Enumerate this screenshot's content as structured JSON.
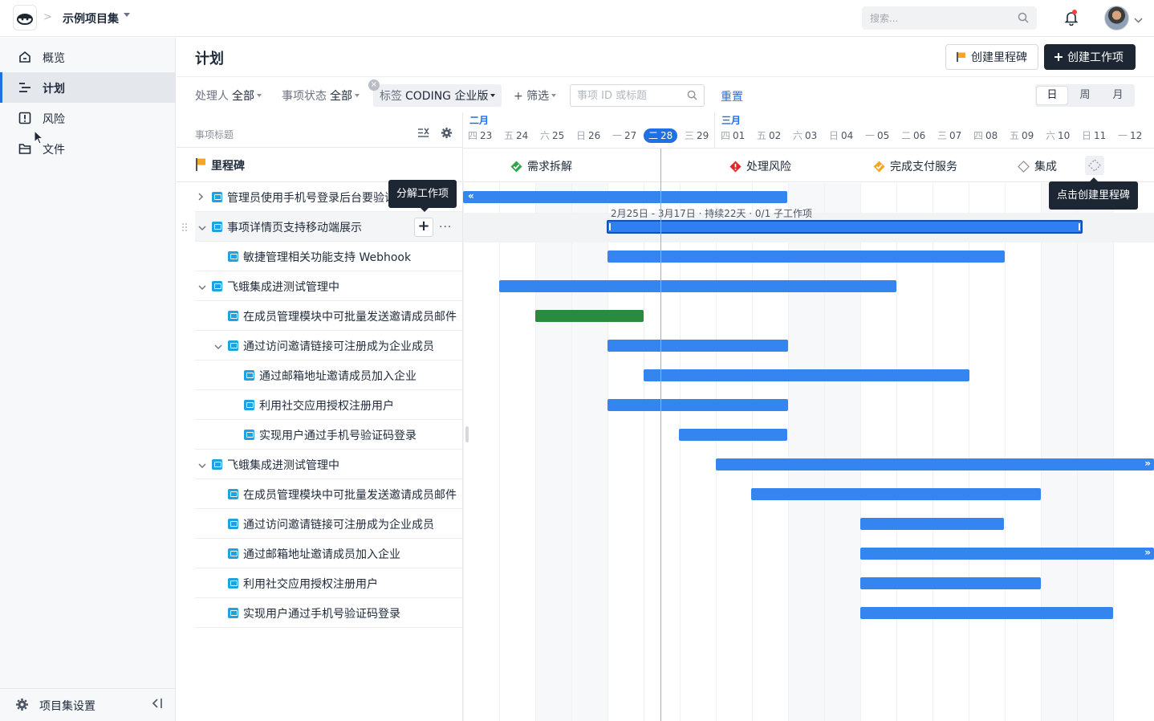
{
  "topbar": {
    "project_name": "示例项目集",
    "search_placeholder": "搜索..."
  },
  "sidebar": {
    "items": [
      {
        "label": "概览",
        "icon": "home-icon"
      },
      {
        "label": "计划",
        "icon": "plan-icon",
        "active": true
      },
      {
        "label": "风险",
        "icon": "risk-icon"
      },
      {
        "label": "文件",
        "icon": "folder-icon"
      }
    ],
    "footer_label": "项目集设置"
  },
  "header": {
    "title": "计划",
    "create_milestone": "创建里程碑",
    "create_item": "创建工作项"
  },
  "filters": {
    "assignee_label": "处理人",
    "assignee_value": "全部",
    "status_label": "事项状态",
    "status_value": "全部",
    "tag_label": "标签",
    "tag_value": "CODING 企业版",
    "more_filter": "+ 筛选",
    "id_placeholder": "事项 ID 或标题",
    "reset": "重置",
    "views": [
      "日",
      "周",
      "月"
    ]
  },
  "list": {
    "header": "事项标题",
    "milestone_label": "里程碑",
    "rows": [
      {
        "label": "管理员使用手机号登录后台要验证"
      },
      {
        "label": "事项详情页支持移动端展示"
      },
      {
        "label": "敏捷管理相关功能支持 Webhook"
      },
      {
        "label": "飞蛾集成进测试管理中"
      },
      {
        "label": "在成员管理模块中可批量发送邀请成员邮件"
      },
      {
        "label": "通过访问邀请链接可注册成为企业成员"
      },
      {
        "label": "通过邮箱地址邀请成员加入企业"
      },
      {
        "label": "利用社交应用授权注册用户"
      },
      {
        "label": "实现用户通过手机号验证码登录"
      },
      {
        "label": "飞蛾集成进测试管理中"
      },
      {
        "label": "在成员管理模块中可批量发送邀请成员邮件"
      },
      {
        "label": "通过访问邀请链接可注册成为企业成员"
      },
      {
        "label": "通过邮箱地址邀请成员加入企业"
      },
      {
        "label": "利用社交应用授权注册用户"
      },
      {
        "label": "实现用户通过手机号验证码登录"
      }
    ]
  },
  "tooltips": {
    "split_item": "分解工作项",
    "create_milestone": "点击创建里程碑"
  },
  "timeline": {
    "months": [
      "二月",
      "三月"
    ],
    "days": [
      {
        "wd": "四",
        "d": "23"
      },
      {
        "wd": "五",
        "d": "24"
      },
      {
        "wd": "六",
        "d": "25"
      },
      {
        "wd": "日",
        "d": "26"
      },
      {
        "wd": "一",
        "d": "27"
      },
      {
        "wd": "二",
        "d": "28"
      },
      {
        "wd": "三",
        "d": "29"
      },
      {
        "wd": "四",
        "d": "01"
      },
      {
        "wd": "五",
        "d": "02"
      },
      {
        "wd": "六",
        "d": "03"
      },
      {
        "wd": "日",
        "d": "04"
      },
      {
        "wd": "一",
        "d": "05"
      },
      {
        "wd": "二",
        "d": "06"
      },
      {
        "wd": "三",
        "d": "07"
      },
      {
        "wd": "四",
        "d": "08"
      },
      {
        "wd": "五",
        "d": "09"
      },
      {
        "wd": "六",
        "d": "10"
      },
      {
        "wd": "日",
        "d": "11"
      },
      {
        "wd": "一",
        "d": "12"
      }
    ],
    "milestones": [
      {
        "label": "需求拆解",
        "status": "done"
      },
      {
        "label": "处理风险",
        "status": "risk"
      },
      {
        "label": "完成支付服务",
        "status": "warning"
      },
      {
        "label": "集成",
        "status": "pending"
      }
    ],
    "selected_bar_info": "2月25日 - 3月17日 · 持续22天 · 0/1 子工作项"
  },
  "colors": {
    "accent": "#1f6fe5",
    "bar": "#3585f0",
    "bar_done": "#2a8a3e",
    "dark_button": "#1d2733"
  }
}
